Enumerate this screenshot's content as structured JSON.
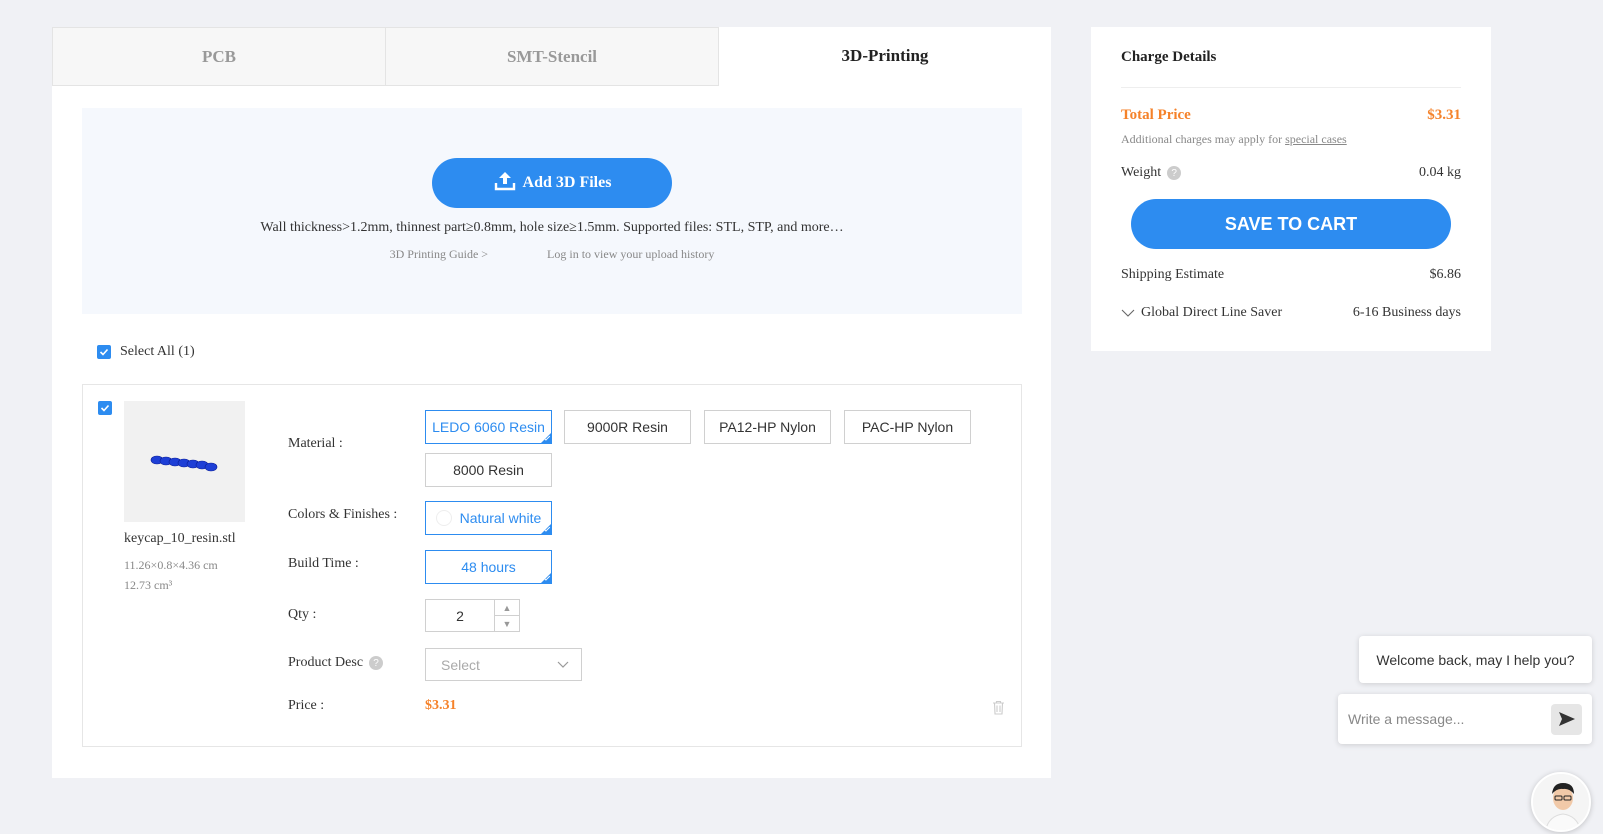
{
  "tabs": [
    {
      "label": "PCB",
      "active": false
    },
    {
      "label": "SMT-Stencil",
      "active": false
    },
    {
      "label": "3D-Printing",
      "active": true
    }
  ],
  "upload": {
    "button_label": "Add 3D Files",
    "hint": "Wall thickness>1.2mm, thinnest part≥0.8mm, hole size≥1.5mm. Supported files: STL, STP, and more…",
    "guide_link": "3D Printing Guide >",
    "history_link": "Log in to view your upload history"
  },
  "select_all_label": "Select All (1)",
  "item": {
    "file_name": "keycap_10_resin.stl",
    "dimensions": "11.26×0.8×4.36 cm",
    "volume": "12.73 cm³",
    "labels": {
      "material": "Material :",
      "colors": "Colors & Finishes :",
      "build_time": "Build Time :",
      "qty": "Qty :",
      "product_desc": "Product Desc",
      "price": "Price :"
    },
    "materials": [
      {
        "label": "LEDO 6060 Resin",
        "selected": true
      },
      {
        "label": "9000R Resin",
        "selected": false
      },
      {
        "label": "PA12-HP Nylon",
        "selected": false
      },
      {
        "label": "PAC-HP Nylon",
        "selected": false
      },
      {
        "label": "8000 Resin",
        "selected": false
      }
    ],
    "color": "Natural white",
    "build_time": "48 hours",
    "qty": "2",
    "product_desc_placeholder": "Select",
    "price": "$3.31"
  },
  "charge": {
    "title": "Charge Details",
    "total_label": "Total Price",
    "total_value": "$3.31",
    "additional_note": "Additional charges may apply for",
    "special_cases": "special cases",
    "weight_label": "Weight",
    "weight_value": "0.04 kg",
    "save_button": "SAVE TO CART",
    "shipping_label": "Shipping Estimate",
    "shipping_value": "$6.86",
    "shipping_method": "Global Direct Line Saver",
    "shipping_time": "6-16 Business days"
  },
  "chat": {
    "greeting": "Welcome back, may I help you?",
    "input_placeholder": "Write a message..."
  },
  "colors": {
    "accent": "#2d8cf0",
    "price": "#f5822a"
  }
}
